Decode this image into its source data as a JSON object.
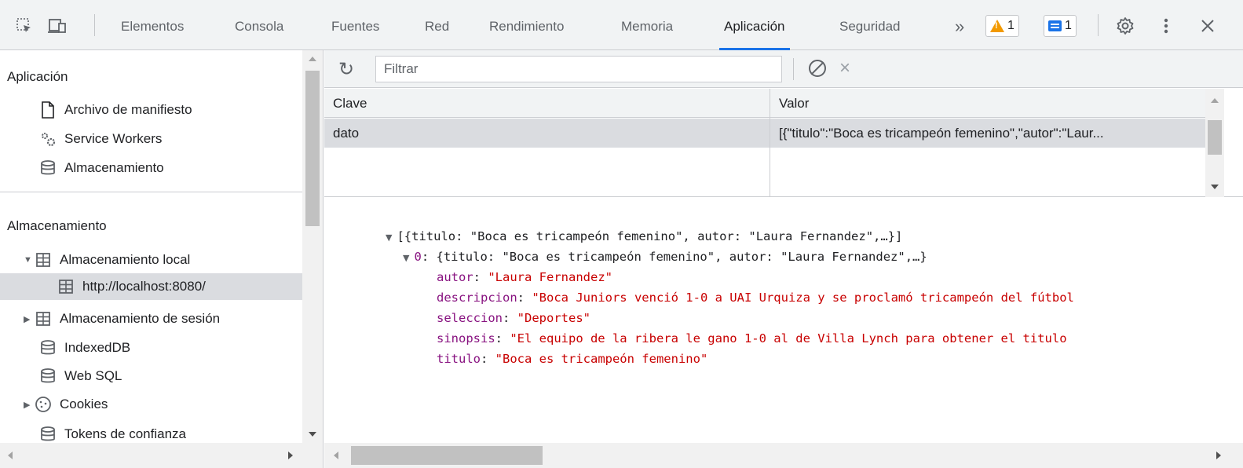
{
  "toolbar": {
    "tabs": [
      {
        "label": "Elementos"
      },
      {
        "label": "Consola"
      },
      {
        "label": "Fuentes"
      },
      {
        "label": "Red"
      },
      {
        "label": "Rendimiento"
      },
      {
        "label": "Memoria"
      },
      {
        "label": "Aplicación",
        "active": true
      },
      {
        "label": "Seguridad"
      }
    ],
    "more_label": "»",
    "warnings_count": "1",
    "messages_count": "1",
    "icons": [
      "inspect-element-icon",
      "device-toolbar-icon",
      "more-tabs-icon",
      "warning-icon",
      "message-icon",
      "settings-gear-icon",
      "kebab-menu-icon",
      "close-icon"
    ],
    "accent_color": "#1a73e8"
  },
  "sidebar": {
    "app_section": {
      "title": "Aplicación",
      "items": [
        {
          "label": "Archivo de manifiesto",
          "icon": "document-icon"
        },
        {
          "label": "Service Workers",
          "icon": "gears-icon"
        },
        {
          "label": "Almacenamiento",
          "icon": "database-icon"
        }
      ]
    },
    "storage_section": {
      "title": "Almacenamiento",
      "items": [
        {
          "label": "Almacenamiento local",
          "icon": "table-icon",
          "expanded": true
        },
        {
          "label": "http://localhost:8080/",
          "icon": "table-icon",
          "selected": true
        },
        {
          "label": "Almacenamiento de sesión",
          "icon": "table-icon",
          "expanded": false
        },
        {
          "label": "IndexedDB",
          "icon": "database-icon"
        },
        {
          "label": "Web SQL",
          "icon": "database-icon"
        },
        {
          "label": "Cookies",
          "icon": "cookie-icon",
          "expanded": false
        },
        {
          "label": "Tokens de confianza",
          "icon": "database-icon"
        }
      ]
    }
  },
  "main": {
    "filter_placeholder": "Filtrar",
    "grid": {
      "columns": [
        "Clave",
        "Valor"
      ],
      "rows": [
        {
          "key": "dato",
          "value": "[{\"titulo\":\"Boca es tricampeón femenino\",\"autor\":\"Laur..."
        }
      ]
    },
    "preview": {
      "root_summary": "[{titulo: \"Boca es tricampeón femenino\", autor: \"Laura Fernandez\",…}]",
      "item_key": "0",
      "item_summary": "{titulo: \"Boca es tricampeón femenino\", autor: \"Laura Fernandez\",…}",
      "props": [
        {
          "key": "autor",
          "value": "\"Laura Fernandez\""
        },
        {
          "key": "descripcion",
          "value": "\"Boca Juniors venció 1-0 a UAI Urquiza y se proclamó tricampeón del fútbol"
        },
        {
          "key": "seleccion",
          "value": "\"Deportes\""
        },
        {
          "key": "sinopsis",
          "value": "\"El equipo de la ribera le gano 1-0 al de Villa Lynch para obtener el titulo"
        },
        {
          "key": "titulo",
          "value": "\"Boca es tricampeón femenino\""
        }
      ]
    }
  }
}
